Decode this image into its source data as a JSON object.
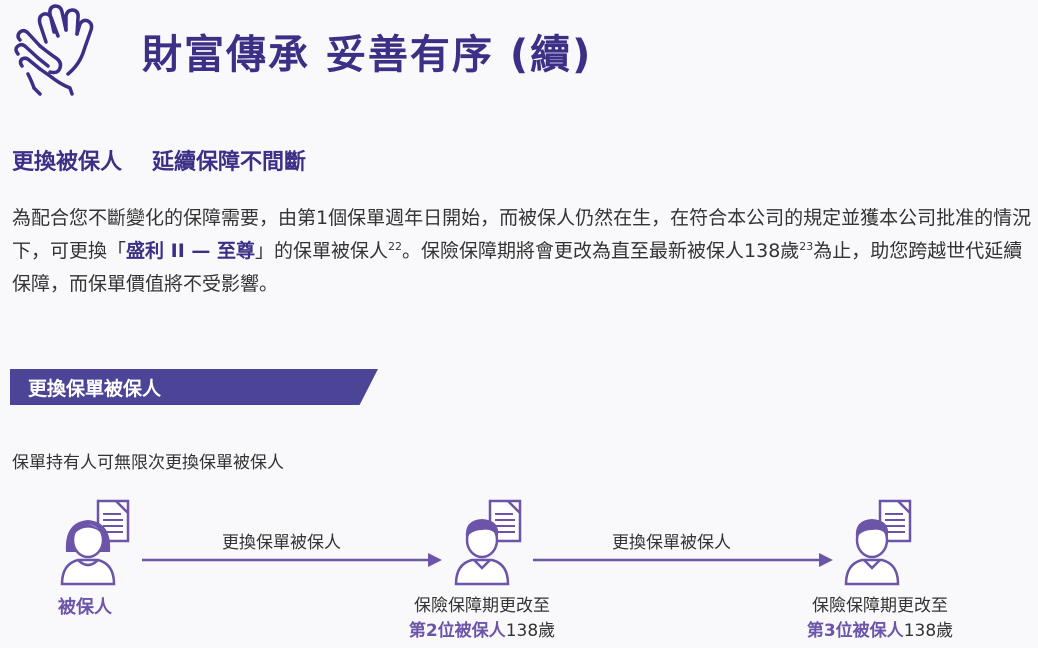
{
  "header": {
    "title": "財富傳承  妥善有序 (續)",
    "icon": "hand-icon"
  },
  "section": {
    "title_part1": "更換被保人",
    "title_part2": "延續保障不間斷"
  },
  "paragraph": {
    "text1": "為配合您不斷變化的保障需要，由第1個保單週年日開始，而被保人仍然在生，在符合本公司的規定並獲本公司批准的情況下，可更換「",
    "highlight": "盛利 II — 至尊",
    "text2": "」的保單被保人",
    "sup1": "22",
    "text3": "。保險保障期將會更改為直至最新被保人138歲",
    "sup2": "23",
    "text4": "為止，助您跨越世代延續保障，而保單價值將不受影響。"
  },
  "banner": {
    "label": "更換保單被保人"
  },
  "note": "保單持有人可無限次更換保單被保人",
  "diagram": {
    "arrow_label_1": "更換保單被保人",
    "arrow_label_2": "更換保單被保人",
    "insured_label": "被保人",
    "caption_2_line1": "保險保障期更改至",
    "caption_2_bold": "第2位被保人",
    "caption_2_age": "138歲",
    "caption_3_line1": "保險保障期更改至",
    "caption_3_bold": "第3位被保人",
    "caption_3_age": "138歲"
  },
  "colors": {
    "title": "#3b2f86",
    "banner": "#4c4597",
    "person": "#6c54a8",
    "arrow": "#6c54a8"
  }
}
